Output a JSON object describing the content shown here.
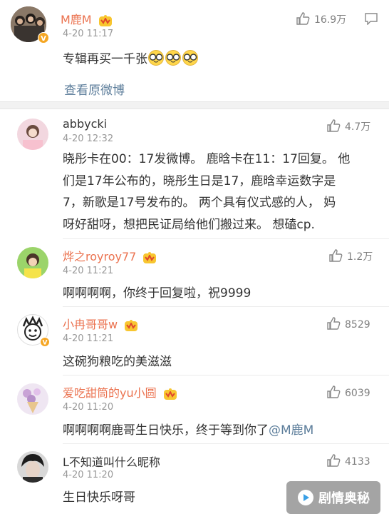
{
  "post": {
    "author": "M鹿M",
    "time": "4-20 11:17",
    "likes": "16.9万",
    "text": "专辑再买一千张",
    "view_original": "查看原微博"
  },
  "comments": [
    {
      "name": "abbycki",
      "time": "4-20 12:32",
      "likes": "4.7万",
      "lines": [
        "晓彤卡在00：17发微博。 鹿晗卡在11：17回复。 他",
        "们是17年公布的，晓彤生日是17，鹿晗幸运数字是",
        "7，新歌是17号发布的。 两个具有仪式感的人， 妈",
        "呀好甜呀，想把民证局给他们搬过来。 想磕cp."
      ]
    },
    {
      "name": "烨之royroy77",
      "time": "4-20 11:21",
      "likes": "1.2万",
      "text": "啊啊啊啊，你终于回复啦，祝9999"
    },
    {
      "name": "小冉哥哥w",
      "time": "4-20 11:21",
      "likes": "8529",
      "text": "这碗狗粮吃的美滋滋"
    },
    {
      "name": "爱吃甜筒的yu小圆",
      "time": "4-20 11:20",
      "likes": "6039",
      "text": "啊啊啊啊鹿哥生日快乐，终于等到你了",
      "mention": "@M鹿M"
    },
    {
      "name": "L不知道叫什么昵称",
      "time": "4-20 11:20",
      "likes": "4133",
      "text": "生日快乐呀哥"
    }
  ],
  "watermark": "剧情奥秘",
  "colors": {
    "accent_name": "#eb7350",
    "link": "#5d7e9b",
    "muted": "#999999"
  }
}
